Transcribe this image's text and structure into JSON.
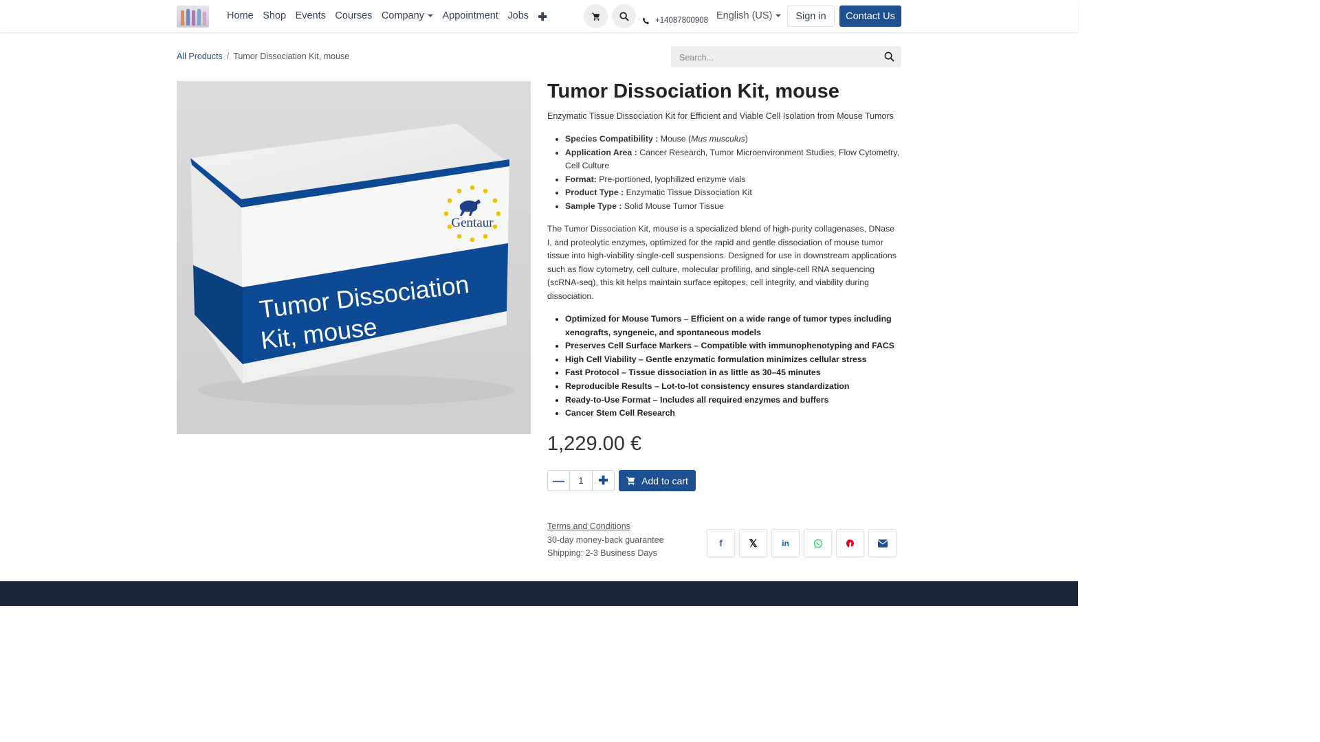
{
  "nav": {
    "items": [
      "Home",
      "Shop",
      "Events",
      "Courses",
      "Company",
      "Appointment",
      "Jobs"
    ],
    "phone": "+14087800908",
    "language": "English (US)",
    "signin": "Sign in",
    "contact": "Contact Us"
  },
  "breadcrumb": {
    "parent": "All Products",
    "current": "Tumor Dissociation Kit, mouse"
  },
  "search": {
    "placeholder": "Search..."
  },
  "product": {
    "image_text_line1": "Tumor Dissociation",
    "image_text_line2": "Kit, mouse",
    "image_brand": "Gentaur",
    "title": "Tumor Dissociation Kit, mouse",
    "subtitle": "Enzymatic Tissue Dissociation Kit for Efficient and Viable Cell Isolation from Mouse Tumors",
    "specs": [
      {
        "label": "Species Compatibility :",
        "value": "Mouse (",
        "italic": "Mus musculus",
        "after": ")"
      },
      {
        "label": "Application Area :",
        "value": "Cancer Research, Tumor Microenvironment Studies, Flow Cytometry, Cell Culture"
      },
      {
        "label": "Format:",
        "value": "Pre-portioned, lyophilized enzyme vials"
      },
      {
        "label": "Product Type :",
        "value": "Enzymatic Tissue Dissociation Kit"
      },
      {
        "label": "Sample Type :",
        "value": "Solid Mouse Tumor Tissue"
      }
    ],
    "description": "The Tumor Dissociation Kit, mouse is a specialized blend of high-purity collagenases, DNase I, and proteolytic enzymes, optimized for the rapid and gentle dissociation of mouse tumor tissue into high-viability single-cell suspensions. Designed for use in downstream applications such as flow cytometry, cell culture, molecular profiling, and single-cell RNA sequencing (scRNA-seq), this kit helps maintain surface epitopes, cell integrity, and viability during dissociation.",
    "features": [
      "Optimized for Mouse Tumors – Efficient on a wide range of tumor types including xenografts, syngeneic, and spontaneous models",
      "Preserves Cell Surface Markers – Compatible with immunophenotyping and FACS",
      "High Cell Viability – Gentle enzymatic formulation minimizes cellular stress",
      "Fast Protocol – Tissue dissociation in as little as 30–45 minutes",
      "Reproducible Results – Lot-to-lot consistency ensures standardization",
      "Ready-to-Use Format – Includes all required enzymes and buffers",
      "Cancer Stem Cell Research"
    ],
    "price": "1,229.00 €",
    "quantity": "1",
    "add_to_cart": "Add to cart"
  },
  "terms": {
    "link": "Terms and Conditions",
    "guarantee": "30-day money-back guarantee",
    "shipping": "Shipping: 2-3 Business Days"
  },
  "share": {
    "icons": [
      "facebook-icon",
      "x-twitter-icon",
      "linkedin-icon",
      "whatsapp-icon",
      "pinterest-icon",
      "email-icon"
    ]
  },
  "colors": {
    "primary": "#1d4f91",
    "footer": "#1b2533",
    "box_band": "#0d4a93"
  }
}
